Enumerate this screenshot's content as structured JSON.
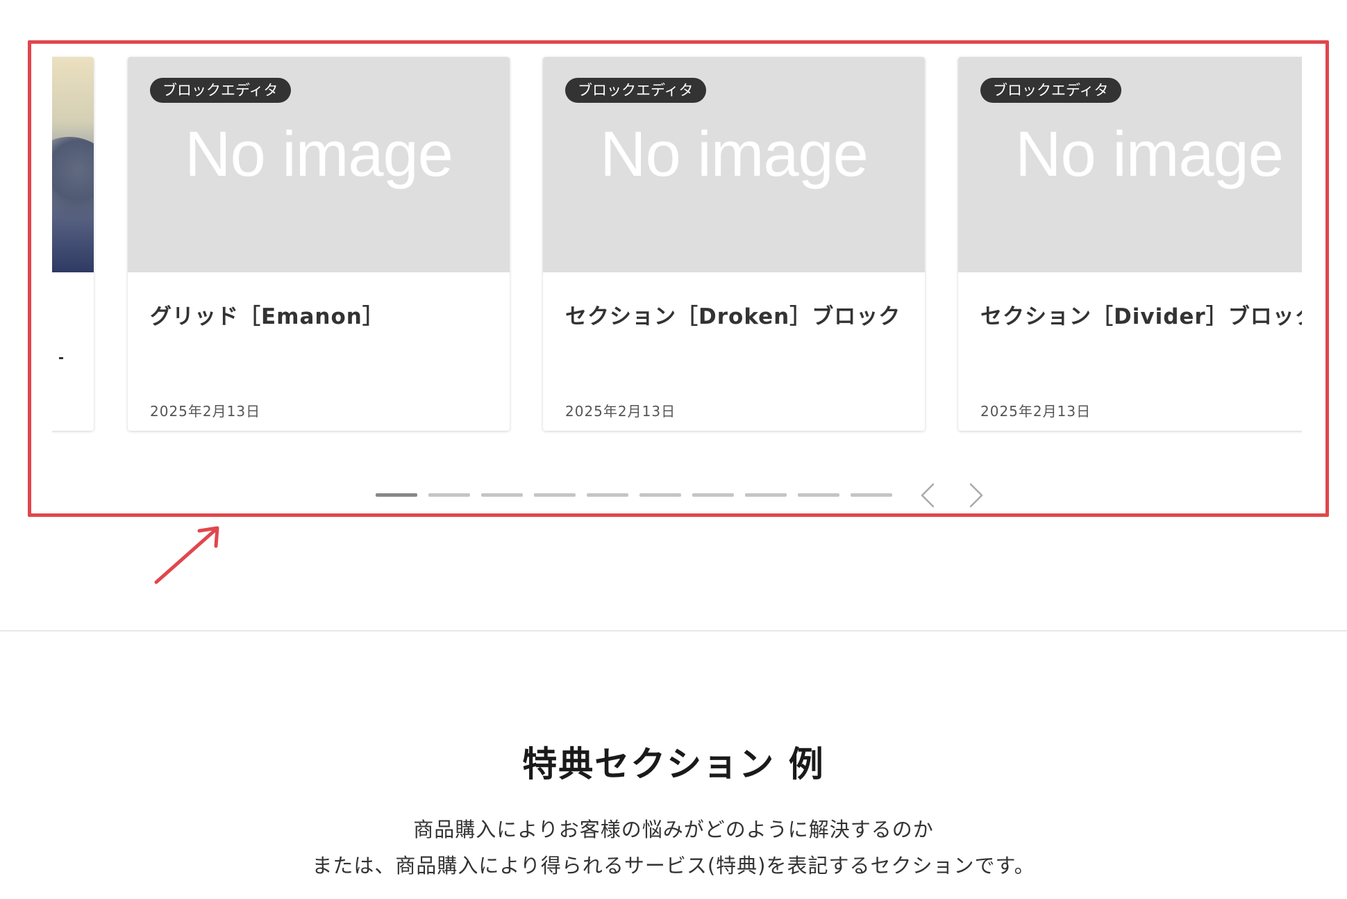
{
  "slider": {
    "cards": [
      {
        "category": "ブロックエディタ",
        "thumb_text": "No image",
        "title": "グリッド［Emanon］",
        "date": "2025年2月13日"
      },
      {
        "category": "ブロックエディタ",
        "thumb_text": "No image",
        "title": "セクション［Droken］ブロック",
        "date": "2025年2月13日"
      },
      {
        "category": "ブロックエディタ",
        "thumb_text": "No image",
        "title": "セクション［Divider］ブロック",
        "date": "2025年2月13日"
      }
    ],
    "pagination": {
      "total": 10,
      "active_index": 1
    },
    "prev_icon": "chevron-left-icon",
    "next_icon": "chevron-right-icon"
  },
  "colors": {
    "highlight_frame": "#e0474c",
    "badge_bg": "#333333",
    "thumb_bg": "#dedede",
    "pager_active": "#888888",
    "pager_inactive": "#c5c5c5"
  },
  "section": {
    "heading": "特典セクション 例",
    "description": [
      "商品購入によりお客様の悩みがどのように解決するのか",
      "または、商品購入により得られるサービス(特典)を表記するセクションです。"
    ]
  }
}
